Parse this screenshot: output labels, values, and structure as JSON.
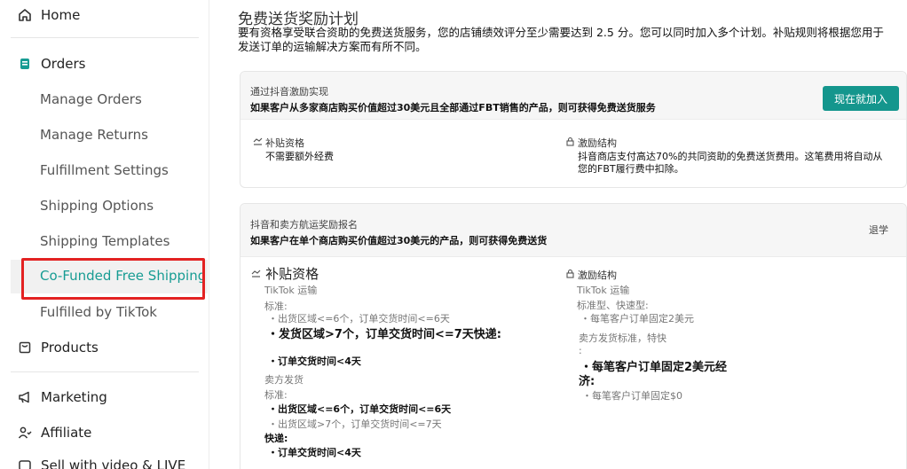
{
  "sidebar": {
    "home": "Home",
    "orders": "Orders",
    "orders_items": [
      "Manage Orders",
      "Manage Returns",
      "Fulfillment Settings",
      "Shipping Options",
      "Shipping Templates"
    ],
    "active": "Co-Funded Free Shipping",
    "fulfilled": "Fulfilled by TikTok",
    "products": "Products",
    "marketing": "Marketing",
    "affiliate": "Affiliate",
    "sell_video": "Sell with video & LIVE"
  },
  "page": {
    "title": "免费送货奖励计划",
    "description": "要有资格享受联合资助的免费送货服务，您的店铺绩效评分至少需要达到 2.5 分。您可以同时加入多个计划。补贴规则将根据您用于发送订单的运输解决方案而有所不同。"
  },
  "card1": {
    "title": "通过抖音激励实现",
    "subtitle": "如果客户从多家商店购买价值超过30美元且全部通过FBT销售的产品，则可获得免费送货服务",
    "button": "现在就加入",
    "eligibility_label": "补贴资格",
    "eligibility_value": "不需要额外经费",
    "structure_label": "激励结构",
    "structure_value_1": "抖音商店支付高达70%的共同资助的免费送货费用。这笔费用将自动从",
    "structure_value_2": "您的FBT履行费中扣除。"
  },
  "card2": {
    "title": "抖音和卖方航运奖励报名",
    "subtitle": "如果客户在单个商店购买价值超过30美元的产品，则可获得免费送货",
    "exit": "退学",
    "left": {
      "heading": "补贴资格",
      "tiktok_shipping": "TikTok 运输",
      "standard": "标准:",
      "std_rule": "・出货区域<=6个，订单交货时间<=6天",
      "big_rule": "・发货区域>7个，订单交货时间<=7天快递:",
      "delivery_4": "・订单交货时间<4天",
      "seller_shipping": "卖方发货",
      "standard2": "标准:",
      "rule_a": "・出货区域<=6个，订单交货时间<=6天",
      "rule_b": "・出货区域>7个，订单交货时间<=7天",
      "express": "快递:",
      "delivery_4b": "・订单交货时间<4天"
    },
    "right": {
      "heading": "激励结构",
      "tiktok_shipping": "TikTok 运输",
      "std_express": "标准型、快速型:",
      "fixed_2": "・每笔客户订单固定2美元",
      "seller_std": "卖方发货标准，特快",
      "colon": ":",
      "big_fixed_1": "・每笔客户订单固定2美元经",
      "big_fixed_2": "济:",
      "fixed_0": "・每笔客户订单固定$0"
    }
  },
  "colors": {
    "accent": "#14968d",
    "highlight_border": "#e32222",
    "active_text": "#179c93"
  }
}
